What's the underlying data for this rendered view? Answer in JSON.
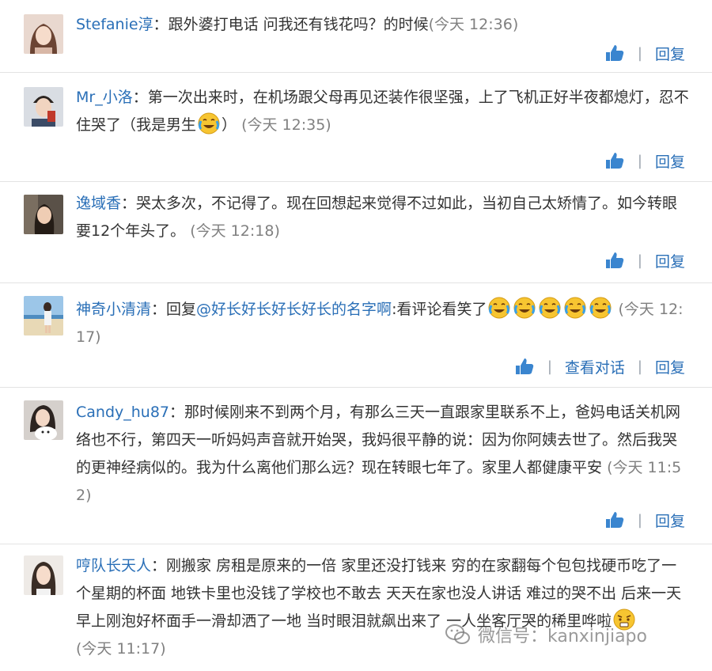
{
  "comments": [
    {
      "user": "Stefanie淳",
      "body": "跟外婆打电话 问我还有钱花吗？的时候",
      "time": "(今天 12:36)",
      "actions": {
        "reply": "回复"
      }
    },
    {
      "user": "Mr_小洛",
      "body": "第一次出来时，在机场跟父母再见还装作很坚强，上了飞机正好半夜都熄灯，忍不住哭了（我是男生",
      "body_after": "）",
      "emoji": "crying-laughing-face",
      "time": "(今天 12:35)",
      "actions": {
        "reply": "回复"
      }
    },
    {
      "user": "逸域香",
      "body": "哭太多次，不记得了。现在回想起来觉得不过如此，当初自己太矫情了。如今转眼要12个年头了。",
      "time": "(今天 12:18)",
      "actions": {
        "reply": "回复"
      }
    },
    {
      "user": "神奇小清清",
      "body": "回复",
      "mention": "@好长好长好长好长的名字啊",
      "body_after": ":看评论看笑了",
      "emoji": "crying-laughing-face",
      "emoji_count": 5,
      "time": "(今天 12:17)",
      "actions": {
        "view_conversation": "查看对话",
        "reply": "回复"
      }
    },
    {
      "user": "Candy_hu87",
      "body": "那时候刚来不到两个月，有那么三天一直跟家里联系不上，爸妈电话关机网络也不行，第四天一听妈妈声音就开始哭，我妈很平静的说：因为你阿姨去世了。然后我哭的更神经病似的。我为什么离他们那么远？现在转眼七年了。家里人都健康平安",
      "time": "(今天 11:52)",
      "actions": {
        "reply": "回复"
      }
    },
    {
      "user": "哼队长天人",
      "body": "刚搬家 房租是原来的一倍 家里还没打钱来 穷的在家翻每个包包找硬币吃了一个星期的杯面 地铁卡里也没钱了学校也不敢去 天天在家也没人讲话 难过的哭不出 后来一天早上刚泡好杯面手一滑却洒了一地 当时眼泪就飙出来了 一人坐客厅哭的稀里哗啦",
      "emoji": "sad-face",
      "time": "(今天 11:17)"
    }
  ],
  "watermark": {
    "text": "微信号：kanxinjiapo"
  }
}
